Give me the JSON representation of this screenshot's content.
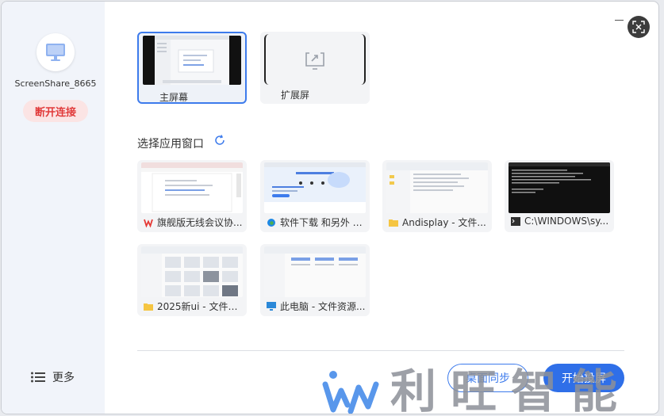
{
  "sidebar": {
    "device_name": "ScreenShare_8665",
    "disconnect_label": "断开连接",
    "more_label": "更多"
  },
  "screens": [
    {
      "label": "主屏幕",
      "selected": true
    },
    {
      "label": "扩展屏",
      "selected": false
    }
  ],
  "apps": {
    "title": "选择应用窗口",
    "windows": [
      {
        "title": "旗舰版无线会议协...",
        "icon": "wps-icon"
      },
      {
        "title": "软件下载 和另外 3...",
        "icon": "edge-icon"
      },
      {
        "title": "Andisplay - 文件...",
        "icon": "folder-icon"
      },
      {
        "title": "C:\\WINDOWS\\sy...",
        "icon": "cmd-icon"
      },
      {
        "title": "2025新ui - 文件资...",
        "icon": "folder-icon"
      },
      {
        "title": "此电脑 - 文件资源...",
        "icon": "computer-icon"
      }
    ]
  },
  "footer": {
    "sync_label": "桌面同步",
    "start_label": "开始投屏"
  },
  "watermark": {
    "text": "利旺智能"
  },
  "colors": {
    "accent": "#2f6fe8",
    "danger": "#e13a3a",
    "sidebar_bg": "#f1f4fa"
  }
}
